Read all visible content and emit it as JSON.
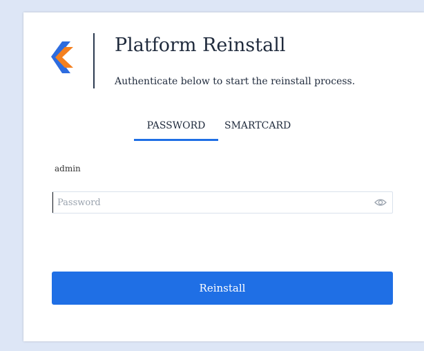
{
  "header": {
    "title": "Platform Reinstall",
    "subtitle": "Authenticate below to start the reinstall process."
  },
  "tabs": [
    {
      "label": "PASSWORD",
      "active": true
    },
    {
      "label": "SMARTCARD",
      "active": false
    }
  ],
  "form": {
    "username": "admin",
    "password_placeholder": "Password",
    "submit_label": "Reinstall"
  },
  "colors": {
    "accent": "#1f6fe5",
    "logo_orange": "#f4801f",
    "logo_blue": "#2d6cdf",
    "text": "#1f2a3c"
  },
  "icons": {
    "logo": "brand-chevron-icon",
    "reveal": "eye-icon"
  }
}
